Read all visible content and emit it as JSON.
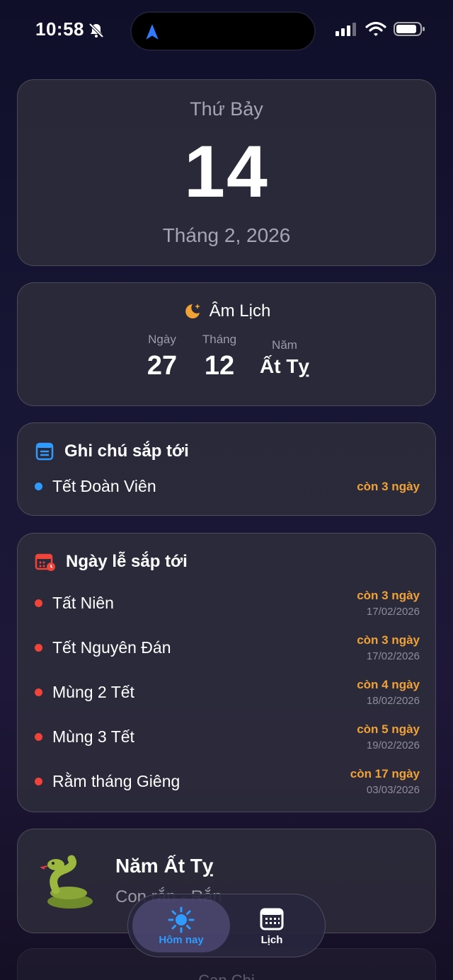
{
  "status_bar": {
    "time": "10:58"
  },
  "today": {
    "weekday": "Thứ Bảy",
    "day": "14",
    "month_year": "Tháng 2, 2026"
  },
  "lunar": {
    "title": "Âm Lịch",
    "day_label": "Ngày",
    "day_value": "27",
    "month_label": "Tháng",
    "month_value": "12",
    "year_label": "Năm",
    "year_value": "Ất Tỵ"
  },
  "notes": {
    "title": "Ghi chú sắp tới",
    "items": [
      {
        "name": "Tết Đoàn Viên",
        "countdown": "còn 3 ngày"
      }
    ]
  },
  "holidays": {
    "title": "Ngày lễ sắp tới",
    "items": [
      {
        "name": "Tất Niên",
        "countdown": "còn 3 ngày",
        "date": "17/02/2026"
      },
      {
        "name": "Tết Nguyên Đán",
        "countdown": "còn 3 ngày",
        "date": "17/02/2026"
      },
      {
        "name": "Mùng 2 Tết",
        "countdown": "còn 4 ngày",
        "date": "18/02/2026"
      },
      {
        "name": "Mùng 3 Tết",
        "countdown": "còn 5 ngày",
        "date": "19/02/2026"
      },
      {
        "name": "Rằm tháng Giêng",
        "countdown": "còn 17 ngày",
        "date": "03/03/2026"
      }
    ]
  },
  "zodiac": {
    "title": "Năm Ất Tỵ",
    "subtitle": "Con rắn - Rắn"
  },
  "ghost": {
    "title": "Can Chi"
  },
  "tabs": [
    {
      "label": "Hôm nay",
      "icon": "sun-icon",
      "active": true
    },
    {
      "label": "Lịch",
      "icon": "calendar-grid-icon",
      "active": false
    }
  ],
  "colors": {
    "accent_blue": "#2f9bff",
    "countdown_orange": "#f0a236",
    "holiday_dot_red": "#f0433a",
    "note_dot_blue": "#2f9bff"
  }
}
